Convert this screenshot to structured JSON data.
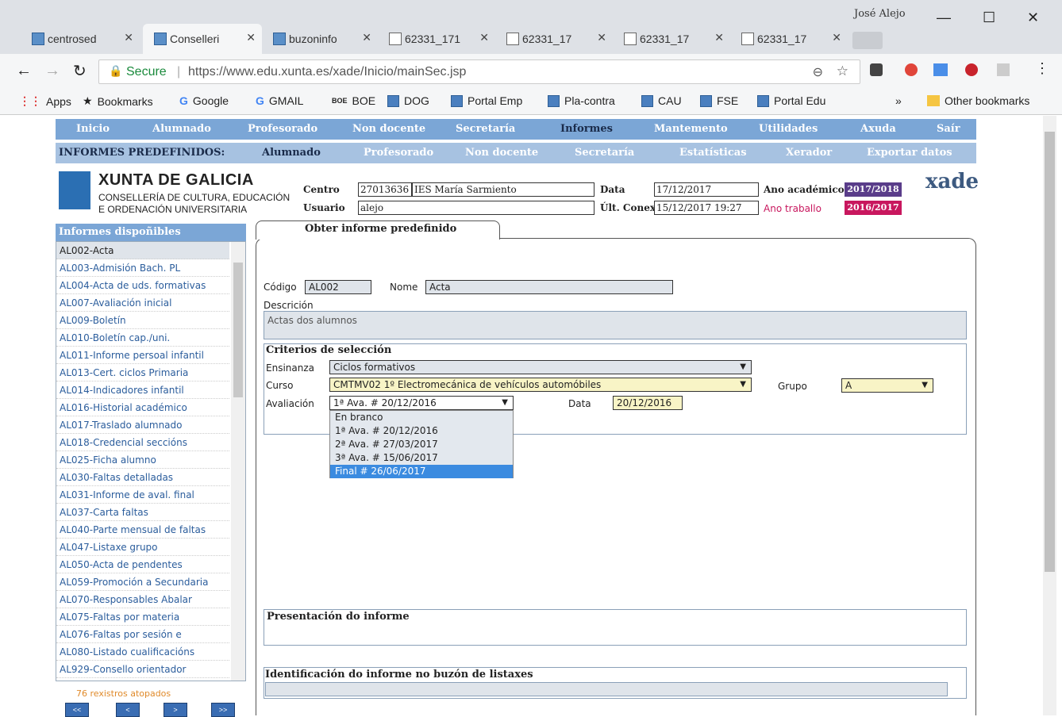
{
  "browser": {
    "user": "José Alejo",
    "tabs": [
      "centrosed",
      "Conselleri",
      "buzoninfo",
      "62331_171",
      "62331_17",
      "62331_17",
      "62331_17"
    ],
    "secure": "Secure",
    "url": "https://www.edu.xunta.es/xade/Inicio/mainSec.jsp"
  },
  "bookmarks": [
    "Apps",
    "Bookmarks",
    "Google",
    "GMAIL",
    "BOE",
    "DOG",
    "Portal Emp",
    "Pla-contra",
    "CAU",
    "FSE",
    "Portal Edu",
    "»",
    "Other bookmarks"
  ],
  "menu1": [
    "Inicio",
    "Alumnado",
    "Profesorado",
    "Non docente",
    "Secretaría",
    "Informes",
    "Mantemento",
    "Utilidades",
    "Axuda",
    "Saír"
  ],
  "menu2": [
    "INFORMES PREDEFINIDOS:",
    "Alumnado",
    "Profesorado",
    "Non docente",
    "Secretaría",
    "Estatísticas",
    "Xerador",
    "Exportar datos"
  ],
  "header": {
    "org1": "XUNTA DE GALICIA",
    "org2": "CONSELLERÍA DE CULTURA, EDUCACIÓN",
    "org3": "E ORDENACIÓN UNIVERSITARIA",
    "centro_label": "Centro",
    "centro_code": "27013636",
    "centro_name": "IES María Sarmiento",
    "usuario_label": "Usuario",
    "usuario": "alejo",
    "data_label": "Data",
    "data": "17/12/2017",
    "ultconex_label": "Últ. Conex",
    "ultconex": "15/12/2017 19:27",
    "ano_acad_label": "Ano académico",
    "ano_acad": "2017/2018",
    "ano_trab_label": "Ano traballo",
    "ano_trab": "2016/2017",
    "logo": "xade"
  },
  "sidebar": {
    "title": "Informes dispoñibles",
    "items": [
      "AL002-Acta",
      "AL003-Admisión Bach. PL",
      "AL004-Acta de uds. formativas",
      "AL007-Avaliación inicial",
      "AL009-Boletín",
      "AL010-Boletín cap./uni.",
      "AL011-Informe persoal infantil",
      "AL013-Cert. ciclos Primaria",
      "AL014-Indicadores infantil",
      "AL016-Historial académico",
      "AL017-Traslado alumnado",
      "AL018-Credencial seccións",
      "AL025-Ficha alumno",
      "AL030-Faltas detalladas",
      "AL031-Informe de aval. final",
      "AL037-Carta faltas",
      "AL040-Parte mensual de faltas",
      "AL047-Listaxe grupo",
      "AL050-Acta de pendentes",
      "AL059-Promoción a Secundaria",
      "AL070-Responsables Abalar",
      "AL075-Faltas por materia",
      "AL076-Faltas por sesión e",
      "AL080-Listado cualificacións",
      "AL929-Consello orientador"
    ],
    "count": "76 rexistros atopados",
    "pager": [
      "<<",
      "<",
      ">",
      ">>"
    ]
  },
  "form": {
    "tab": "Obter informe predefinido",
    "codigo_label": "Código",
    "codigo": "AL002",
    "nome_label": "Nome",
    "nome": "Acta",
    "descricion_label": "Descrición",
    "descricion": "Actas dos alumnos",
    "criterios": "Criterios de selección",
    "ensinanza_label": "Ensinanza",
    "ensinanza": "Ciclos formativos",
    "curso_label": "Curso",
    "curso": "CMTMV02 1º Electromecánica de vehículos automóbiles",
    "grupo_label": "Grupo",
    "grupo": "A",
    "avaliacion_label": "Avaliación",
    "avaliacion": "1ª Ava. # 20/12/2016",
    "data_label": "Data",
    "data": "20/12/2016",
    "options": [
      "En branco",
      "1ª Ava. # 20/12/2016",
      "2ª Ava. # 27/03/2017",
      "3ª Ava. # 15/06/2017",
      "Final # 26/06/2017"
    ],
    "presentacion": "Presentación do informe",
    "identificacion": "Identificación do informe no buzón de listaxes"
  }
}
